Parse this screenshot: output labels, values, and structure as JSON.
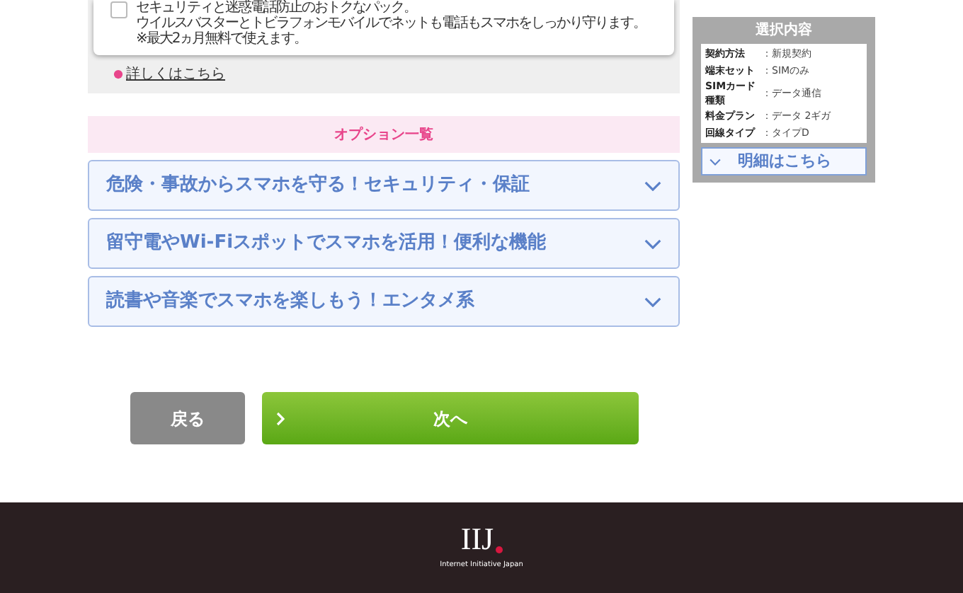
{
  "plan_card": {
    "checked": false,
    "lines": [
      "セキュリティと迷惑電話防止のおトクなパック。",
      "ウイルスバスターとトビラフォンモバイルでネットも電話もスマホをしっかり守ります。",
      "※最大2ヵ月無料で使えます。"
    ]
  },
  "details_link": "詳しくはこちら",
  "options": {
    "heading": "オプション一覧",
    "items": [
      {
        "label": "危険・事故からスマホを守る！セキュリティ・保証",
        "expanded": false
      },
      {
        "label": "留守電やWi-Fiスポットでスマホを活用！便利な機能",
        "expanded": false
      },
      {
        "label": "読書や音楽でスマホを楽しもう！エンタメ系",
        "expanded": false
      }
    ]
  },
  "buttons": {
    "back": "戻る",
    "next": "次へ"
  },
  "summary": {
    "title": "選択内容",
    "rows": [
      {
        "label": "契約方法",
        "value": "：新規契約"
      },
      {
        "label": "端末セット",
        "value": "：SIMのみ"
      },
      {
        "label": "SIMカード種類",
        "value": "：データ通信"
      },
      {
        "label": "料金プラン",
        "value": "：データ 2ギガ"
      },
      {
        "label": "回線タイプ",
        "value": "：タイプD"
      }
    ],
    "button": "明細はこちら"
  },
  "footer": {
    "logo": "IIJ",
    "tagline": "Internet Initiative Japan"
  }
}
